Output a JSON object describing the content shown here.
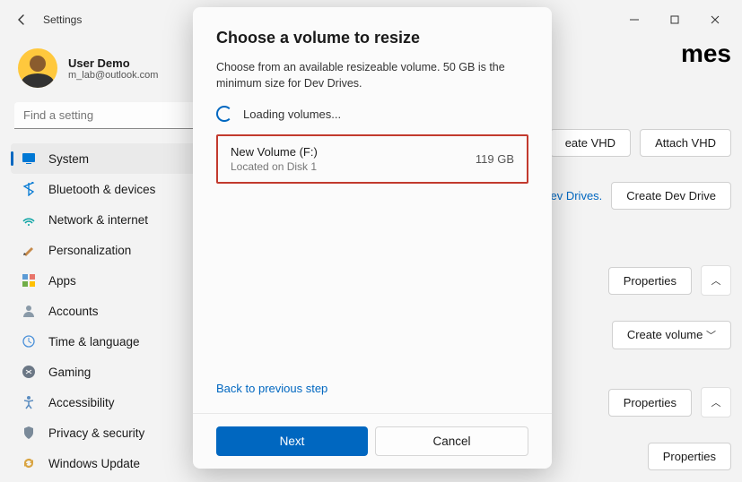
{
  "window": {
    "title": "Settings"
  },
  "user": {
    "name": "User Demo",
    "email": "m_lab@outlook.com"
  },
  "search": {
    "placeholder": "Find a setting"
  },
  "sidebar": {
    "items": [
      {
        "label": "System",
        "icon": "system-icon",
        "active": true
      },
      {
        "label": "Bluetooth & devices",
        "icon": "bluetooth-icon"
      },
      {
        "label": "Network & internet",
        "icon": "network-icon"
      },
      {
        "label": "Personalization",
        "icon": "personalization-icon"
      },
      {
        "label": "Apps",
        "icon": "apps-icon"
      },
      {
        "label": "Accounts",
        "icon": "accounts-icon"
      },
      {
        "label": "Time & language",
        "icon": "time-icon"
      },
      {
        "label": "Gaming",
        "icon": "gaming-icon"
      },
      {
        "label": "Accessibility",
        "icon": "accessibility-icon"
      },
      {
        "label": "Privacy & security",
        "icon": "privacy-icon"
      },
      {
        "label": "Windows Update",
        "icon": "update-icon"
      }
    ]
  },
  "main": {
    "page_title_suffix": "mes",
    "buttons": {
      "create_vhd": "eate VHD",
      "attach_vhd": "Attach VHD",
      "create_dev_drive": "Create Dev Drive"
    },
    "link_dev": "Dev Drives.",
    "cards": [
      {
        "label": "Properties",
        "chev": "up"
      },
      {
        "label": "Create volume",
        "chev": "down"
      },
      {
        "label": "Properties",
        "chev": "up"
      },
      {
        "label": "Properties"
      }
    ]
  },
  "dialog": {
    "title": "Choose a volume to resize",
    "desc": "Choose from an available resizeable volume. 50 GB is the minimum size for Dev Drives.",
    "loading": "Loading volumes...",
    "volume": {
      "name": "New Volume (F:)",
      "location": "Located on Disk 1",
      "size": "119 GB"
    },
    "back_link": "Back to previous step",
    "next": "Next",
    "cancel": "Cancel"
  }
}
